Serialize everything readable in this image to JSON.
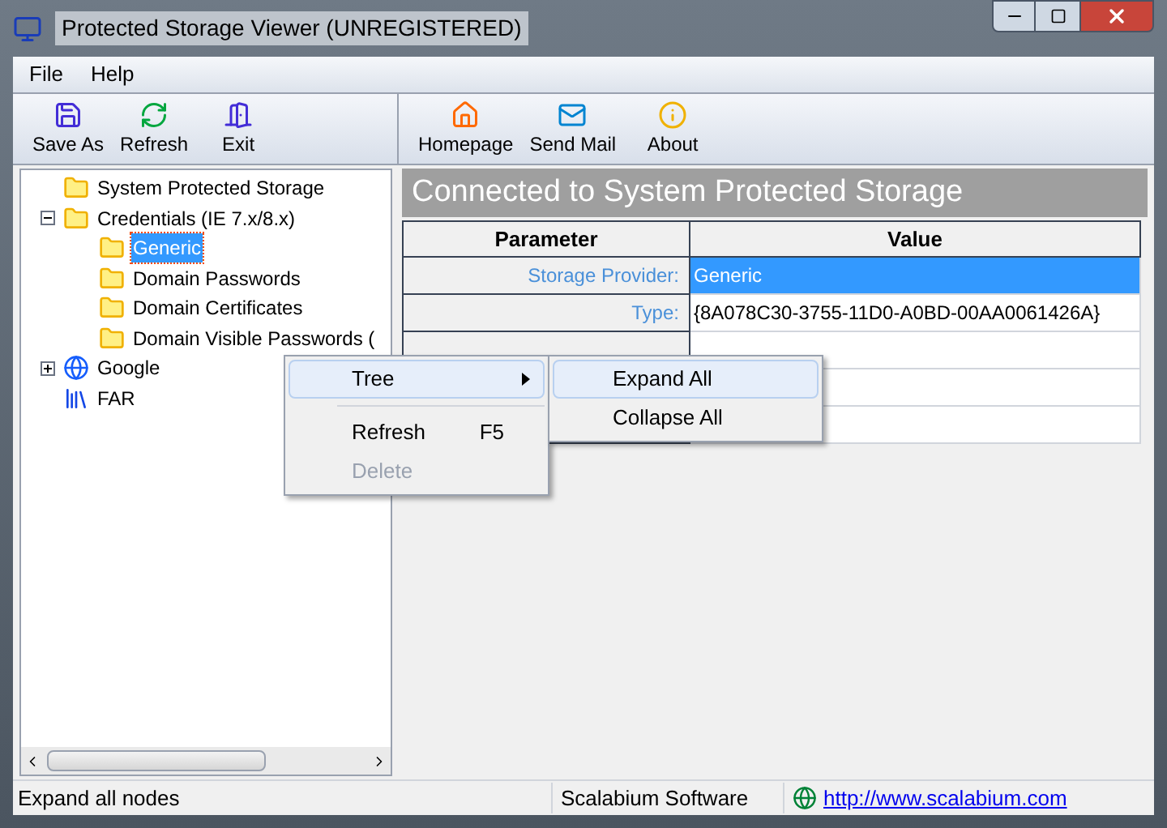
{
  "window": {
    "title": "Protected Storage Viewer (UNREGISTERED)"
  },
  "menu": [
    "File",
    "Help"
  ],
  "toolbar": [
    {
      "label": "Save As",
      "kind": "save"
    },
    {
      "label": "Refresh",
      "kind": "refresh"
    },
    {
      "label": "Exit",
      "kind": "exit"
    }
  ],
  "toolbar_2": [
    {
      "label": "Homepage",
      "kind": "home"
    },
    {
      "label": "Send Mail",
      "kind": "mail"
    },
    {
      "label": "About",
      "kind": "about"
    }
  ],
  "tree": [
    {
      "label": "System Protected Storage",
      "kind": "folder",
      "selected": false
    },
    {
      "label": "Credentials (IE 7.x/8.x)",
      "kind": "folder",
      "selected": false,
      "expanded": true,
      "children": [
        {
          "label": "Generic",
          "kind": "folder",
          "selected": true
        },
        {
          "label": "Domain Passwords",
          "kind": "folder",
          "selected": false
        },
        {
          "label": "Domain Certificates",
          "kind": "folder",
          "selected": false
        },
        {
          "label": "Domain Visible Passwords (",
          "kind": "folder",
          "selected": false
        }
      ]
    },
    {
      "label": "Google",
      "kind": "globe",
      "selected": false,
      "expanded": false
    },
    {
      "label": "FAR",
      "kind": "books",
      "selected": false
    }
  ],
  "header": "Connected to System Protected Storage",
  "table": {
    "columns": [
      "Parameter",
      "Value"
    ],
    "rows": [
      {
        "parameter": "Storage Provider:",
        "value": "Generic",
        "selected": true
      },
      {
        "parameter": "Type:",
        "value": "{8A078C30-3755-11D0-A0BD-00AA0061426A}",
        "selected": false
      },
      {
        "parameter": "",
        "value": "",
        "selected": false
      },
      {
        "parameter": "",
        "value": "",
        "selected": false
      },
      {
        "parameter": "",
        "value": "",
        "selected": false
      }
    ]
  },
  "context_menu": [
    {
      "label": "Tree",
      "kind": "submenu",
      "highlighted": true,
      "disabled": false
    },
    {
      "label": "Refresh",
      "shortcut": "F5",
      "kind": "item",
      "highlighted": false,
      "disabled": false
    },
    {
      "label": "Delete",
      "kind": "item",
      "highlighted": false,
      "disabled": true
    }
  ],
  "submenu": [
    {
      "label": "Expand All",
      "highlighted": true
    },
    {
      "label": "Collapse All",
      "highlighted": false
    }
  ],
  "status_bar": {
    "message": "Expand all nodes",
    "company": "Scalabium Software",
    "link": "http://www.scalabium.com"
  }
}
